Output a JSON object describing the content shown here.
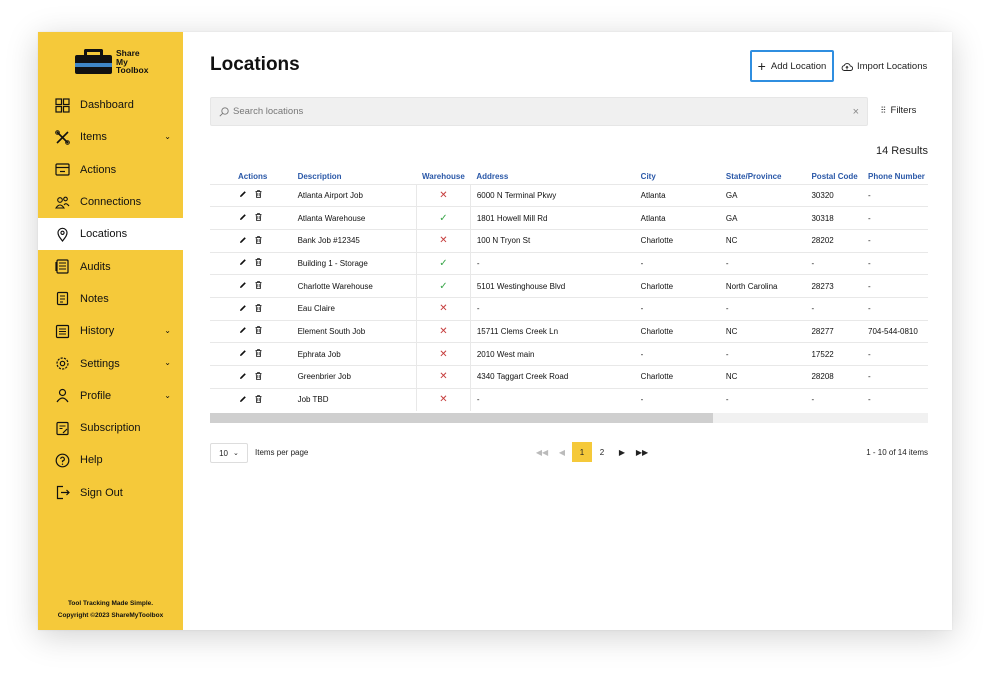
{
  "brand": {
    "line1": "Share",
    "line2": "My",
    "line3": "Toolbox"
  },
  "sidebar": {
    "items": [
      {
        "label": "Dashboard",
        "icon": "dashboard-icon",
        "chevron": false,
        "active": false
      },
      {
        "label": "Items",
        "icon": "tools-icon",
        "chevron": true,
        "active": false
      },
      {
        "label": "Actions",
        "icon": "actions-icon",
        "chevron": false,
        "active": false
      },
      {
        "label": "Connections",
        "icon": "connections-icon",
        "chevron": false,
        "active": false
      },
      {
        "label": "Locations",
        "icon": "location-pin-icon",
        "chevron": false,
        "active": true
      },
      {
        "label": "Audits",
        "icon": "audits-icon",
        "chevron": false,
        "active": false
      },
      {
        "label": "Notes",
        "icon": "notes-icon",
        "chevron": false,
        "active": false
      },
      {
        "label": "History",
        "icon": "history-icon",
        "chevron": true,
        "active": false
      },
      {
        "label": "Settings",
        "icon": "gear-icon",
        "chevron": true,
        "active": false
      },
      {
        "label": "Profile",
        "icon": "user-icon",
        "chevron": true,
        "active": false
      },
      {
        "label": "Subscription",
        "icon": "subscription-icon",
        "chevron": false,
        "active": false
      },
      {
        "label": "Help",
        "icon": "help-icon",
        "chevron": false,
        "active": false
      },
      {
        "label": "Sign Out",
        "icon": "sign-out-icon",
        "chevron": false,
        "active": false
      }
    ],
    "footer_tagline": "Tool Tracking Made Simple.",
    "footer_copyright": "Copyright ©2023 ShareMyToolbox"
  },
  "header": {
    "title": "Locations",
    "add_label": "Add Location",
    "import_label": "Import Locations"
  },
  "search": {
    "placeholder": "Search locations",
    "value": ""
  },
  "filters_label": "Filters",
  "results_label": "14 Results",
  "table": {
    "columns": [
      "Actions",
      "Description",
      "Warehouse",
      "Address",
      "City",
      "State/Province",
      "Postal Code",
      "Phone Number"
    ],
    "rows": [
      {
        "description": "Atlanta Airport Job",
        "warehouse": false,
        "address": "6000 N Terminal Pkwy",
        "city": "Atlanta",
        "state": "GA",
        "postal": "30320",
        "phone": "-"
      },
      {
        "description": "Atlanta Warehouse",
        "warehouse": true,
        "address": "1801 Howell Mill Rd",
        "city": "Atlanta",
        "state": "GA",
        "postal": "30318",
        "phone": "-"
      },
      {
        "description": "Bank Job #12345",
        "warehouse": false,
        "address": "100 N Tryon St",
        "city": "Charlotte",
        "state": "NC",
        "postal": "28202",
        "phone": "-"
      },
      {
        "description": "Building 1 - Storage",
        "warehouse": true,
        "address": "-",
        "city": "-",
        "state": "-",
        "postal": "-",
        "phone": "-"
      },
      {
        "description": "Charlotte Warehouse",
        "warehouse": true,
        "address": "5101 Westinghouse Blvd",
        "city": "Charlotte",
        "state": "North Carolina",
        "postal": "28273",
        "phone": "-"
      },
      {
        "description": "Eau Claire",
        "warehouse": false,
        "address": "-",
        "city": "-",
        "state": "-",
        "postal": "-",
        "phone": "-"
      },
      {
        "description": "Element South Job",
        "warehouse": false,
        "address": "15711 Clems Creek Ln",
        "city": "Charlotte",
        "state": "NC",
        "postal": "28277",
        "phone": "704-544-0810"
      },
      {
        "description": "Ephrata Job",
        "warehouse": false,
        "address": "2010 West main",
        "city": "-",
        "state": "-",
        "postal": "17522",
        "phone": "-"
      },
      {
        "description": "Greenbrier Job",
        "warehouse": false,
        "address": "4340 Taggart Creek Road",
        "city": "Charlotte",
        "state": "NC",
        "postal": "28208",
        "phone": "-"
      },
      {
        "description": "Job TBD",
        "warehouse": false,
        "address": "-",
        "city": "-",
        "state": "-",
        "postal": "-",
        "phone": "-"
      }
    ]
  },
  "pagination": {
    "page_size": "10",
    "items_per_page_label": "Items per page",
    "pages": [
      "1",
      "2"
    ],
    "current_page": "1",
    "range_label": "1 - 10 of 14 items"
  },
  "colors": {
    "sidebar": "#f5c93a",
    "accent_blue": "#2f8ee0",
    "header_text": "#2a58a8",
    "no_mark": "#c63d3d",
    "yes_mark": "#3aa64a"
  }
}
